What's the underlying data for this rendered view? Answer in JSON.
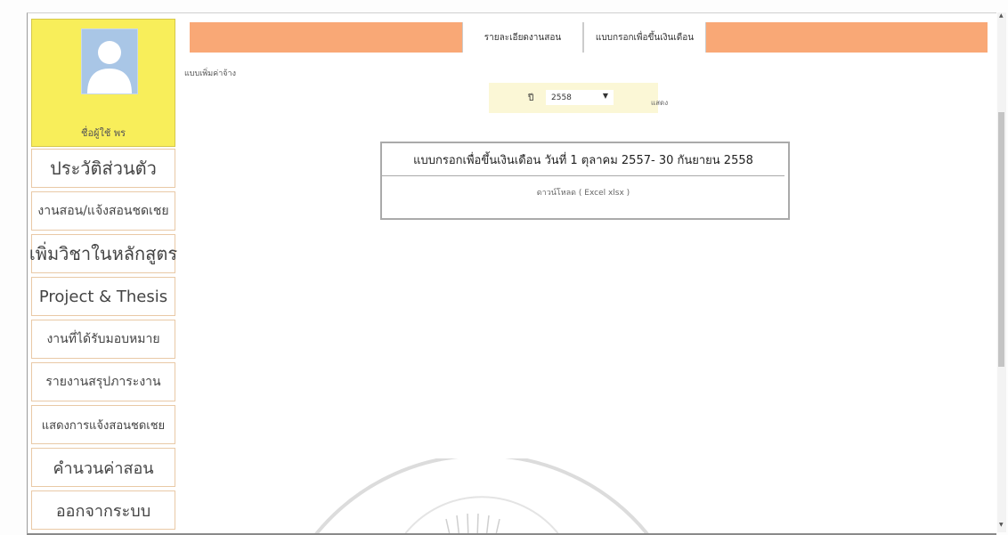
{
  "sidebar": {
    "username": "ชื่อผู้ใช้ พร",
    "items": [
      {
        "label": "ประวัติส่วนตัว",
        "size": 20
      },
      {
        "label": "งานสอน/แจ้งสอนชดเชย",
        "size": 14
      },
      {
        "label": "เพิ่มวิชาในหลักสูตร",
        "size": 20
      },
      {
        "label": "Project & Thesis",
        "size": 18
      },
      {
        "label": "งานที่ได้รับมอบหมาย",
        "size": 14
      },
      {
        "label": "รายงานสรุปภาระงาน",
        "size": 14
      },
      {
        "label": "แสดงการแจ้งสอนชดเชย",
        "size": 13
      },
      {
        "label": "คำนวนค่าสอน",
        "size": 18
      },
      {
        "label": "ออกจากระบบ",
        "size": 18
      }
    ]
  },
  "topbar": {
    "tabs": [
      {
        "label": "รายละเอียดงานสอน"
      },
      {
        "label": "แบบกรอกเพื่อขึ้นเงินเดือน"
      }
    ]
  },
  "page_label": "แบบเพิ่มค่าจ้าง",
  "year_filter": {
    "label": "ปี",
    "selected": "2558",
    "show_button": "แสดง"
  },
  "form_table": {
    "title": "แบบกรอกเพื่อขึ้นเงินเดือน วันที่ 1 ตุลาคม 2557- 30 กันยายน 2558",
    "download": "ดาวน์โหลด ( Excel xlsx )"
  },
  "colors": {
    "profile_bg": "#f8ee5a",
    "topbar_bg": "#f9a876",
    "menu_border": "#e9c9a6"
  },
  "icons": {
    "avatar": "user-silhouette-icon",
    "dropdown": "chevron-down-icon",
    "scroll_up": "arrow-up-icon",
    "scroll_down": "arrow-down-icon"
  }
}
